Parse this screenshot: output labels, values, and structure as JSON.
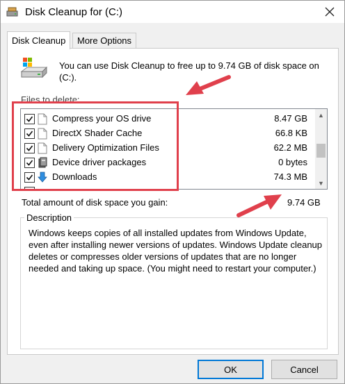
{
  "window": {
    "title": "Disk Cleanup for  (C:)"
  },
  "tabs": [
    {
      "label": "Disk Cleanup",
      "active": true
    },
    {
      "label": "More Options",
      "active": false
    }
  ],
  "intro": "You can use Disk Cleanup to free up to 9.74 GB of disk space on (C:).",
  "files_label": "Files to delete:",
  "files": [
    {
      "name": "Compress your OS drive",
      "size": "8.47 GB",
      "checked": true,
      "icon": "file-icon"
    },
    {
      "name": "DirectX Shader Cache",
      "size": "66.8 KB",
      "checked": true,
      "icon": "file-icon"
    },
    {
      "name": "Delivery Optimization Files",
      "size": "62.2 MB",
      "checked": true,
      "icon": "file-icon"
    },
    {
      "name": "Device driver packages",
      "size": "0 bytes",
      "checked": true,
      "icon": "driver-icon"
    },
    {
      "name": "Downloads",
      "size": "74.3 MB",
      "checked": true,
      "icon": "download-arrow-icon"
    }
  ],
  "total": {
    "label": "Total amount of disk space you gain:",
    "value": "9.74 GB"
  },
  "description": {
    "legend": "Description",
    "text": "Windows keeps copies of all installed updates from Windows Update, even after installing newer versions of updates. Windows Update cleanup deletes or compresses older versions of updates that are no longer needed and taking up space. (You might need to restart your computer.)"
  },
  "buttons": {
    "ok": "OK",
    "cancel": "Cancel"
  },
  "colors": {
    "annotation": "#e0404c",
    "accent": "#0078d7"
  }
}
